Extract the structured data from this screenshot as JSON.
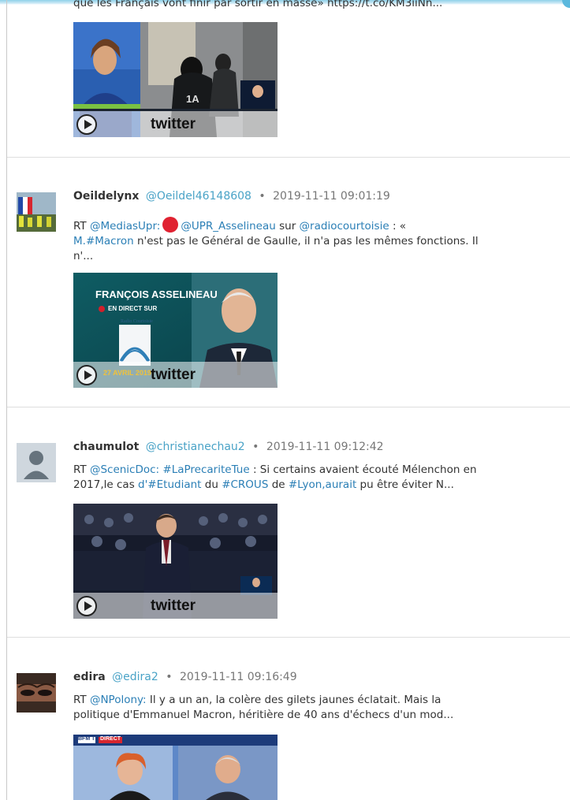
{
  "window": {
    "accent_color": "#5bb8dd"
  },
  "tweets": [
    {
      "text_lines": [
        "que les Français vont finir par sortir en masse» https://t.co/KM3iiNn..."
      ],
      "media": {
        "label": "twitter"
      }
    },
    {
      "name": "Oeildelynx",
      "handle": "@Oeildel46148608",
      "separator": "•",
      "timestamp": "2019-11-11 09:01:19",
      "text": {
        "rt": "RT",
        "mention1": "@MediasUpr:",
        "mention2": "@UPR_Asselineau",
        "t1": "sur",
        "mention3": "@radiocourtoisie",
        "t2": ": «",
        "hashtag1": "M.#Macron",
        "t3": "n'est pas le Général de Gaulle, il n'a pas les mêmes fonctions. Il",
        "t4": "n'..."
      },
      "media": {
        "label": "twitter",
        "overlay_title": "FRANÇOIS ASSELINEAU",
        "overlay_sub": "EN DIRECT SUR",
        "overlay_logo": "Radio Courtoisie",
        "overlay_date": "27 AVRIL 2019"
      }
    },
    {
      "name": "chaumulot",
      "handle": "@christianechau2",
      "separator": "•",
      "timestamp": "2019-11-11 09:12:42",
      "text": {
        "rt": "RT",
        "mention1": "@ScenicDoc:",
        "hashtag1": "#LaPrecariteTue",
        "t1": ": Si certains avaient écouté Mélenchon en",
        "t2": "2017,le cas",
        "hashtag2": "d'#Etudiant",
        "t3": "du",
        "hashtag3": "#CROUS",
        "t4": "de",
        "hashtag4": "#Lyon,aurait",
        "t5": "pu être éviter N..."
      },
      "media": {
        "label": "twitter"
      }
    },
    {
      "name": "edira",
      "handle": "@edira2",
      "separator": "•",
      "timestamp": "2019-11-11 09:16:49",
      "text": {
        "rt": "RT",
        "mention1": "@NPolony:",
        "t1": "Il y a un an, la colère des gilets jaunes éclatait. Mais la",
        "t2": "politique d'Emmanuel Macron, héritière de 40 ans d'échecs d'un mod..."
      },
      "media": {
        "overlay_channel": "BFM TV",
        "overlay_badge": "DIRECT"
      }
    }
  ],
  "icons": {
    "play": "play-icon",
    "default_avatar": "default-avatar-icon"
  }
}
